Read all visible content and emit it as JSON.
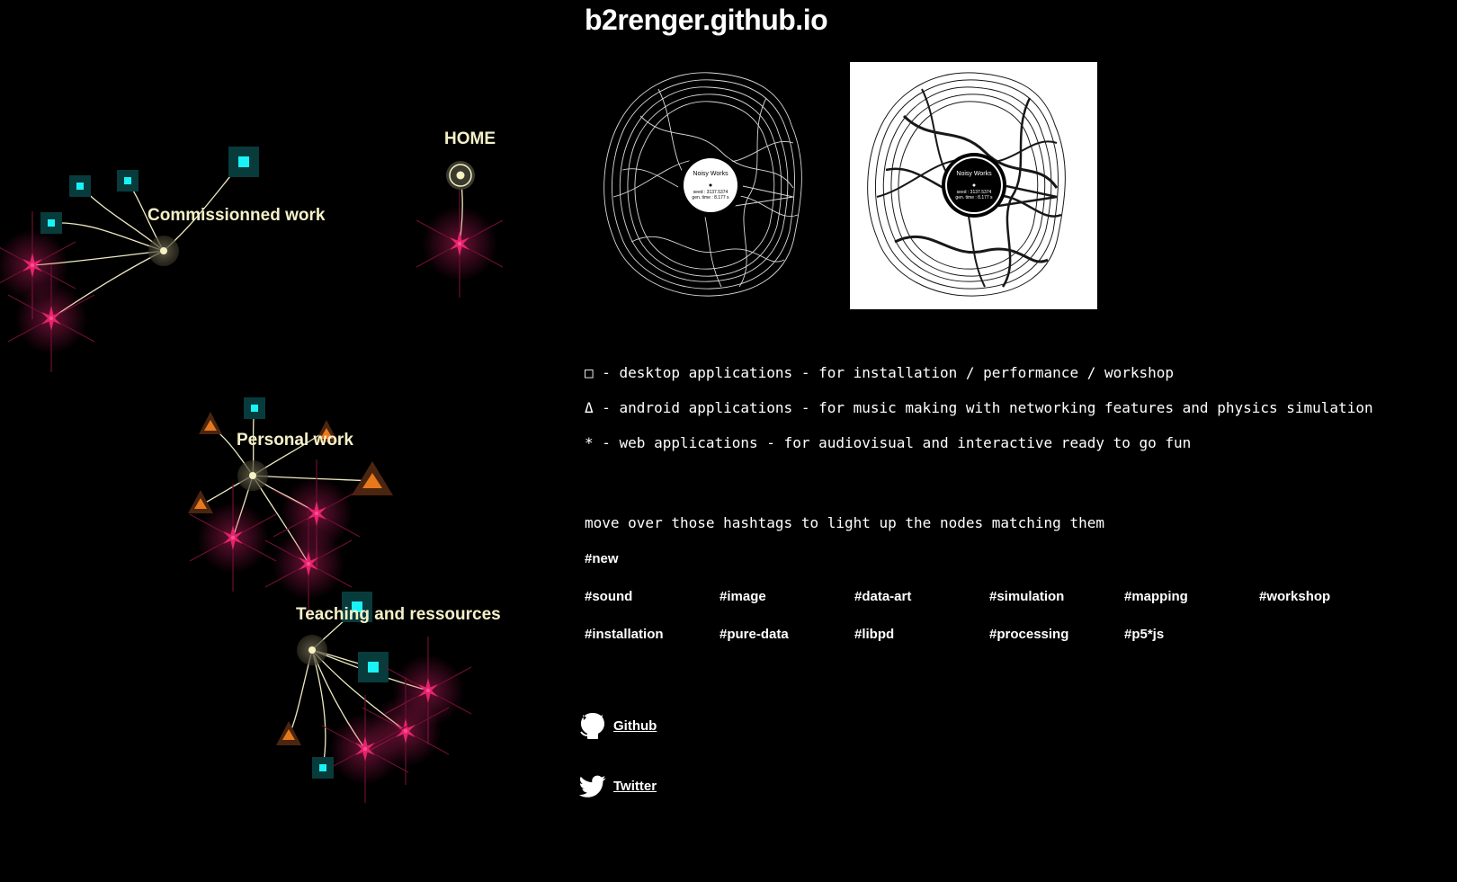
{
  "site": {
    "title": "b2renger.github.io"
  },
  "graph": {
    "home_label": "HOME",
    "commissioned_label": "Commissionned work",
    "personal_label": "Personal work",
    "teaching_label": "Teaching and ressources"
  },
  "previews": {
    "dark": {
      "title": "Noisy Works",
      "seed": "seed : 3137.5374",
      "gen_time": "gen. time : 8.177 s"
    },
    "light": {
      "title": "Noisy Works",
      "seed": "seed : 3137.5374",
      "gen_time": "gen. time : 8.177 s"
    }
  },
  "legend": [
    "□ - desktop applications - for installation / performance / workshop",
    "Δ - android applications - for music making with networking features and physics simulation",
    "* - web applications - for audiovisual and interactive ready to go fun"
  ],
  "hint": "move over those hashtags to light up the nodes matching them",
  "tags": [
    "#new",
    "#sound",
    "#image",
    "#data-art",
    "#simulation",
    "#mapping",
    "#workshop",
    "#installation",
    "#pure-data",
    "#libpd",
    "#processing",
    "#p5*js"
  ],
  "links": {
    "github": "Github",
    "twitter": "Twitter"
  },
  "colors": {
    "background": "#000000",
    "desktop_node": "#19f3f5",
    "android_node": "#e7781c",
    "web_node": "#e8236e",
    "hub": "#f6f2c4",
    "label": "#f4f1c8"
  },
  "icons": {
    "desktop": "square",
    "android": "triangle",
    "web": "star",
    "github": "github-octocat-icon",
    "twitter": "twitter-bird-icon"
  }
}
